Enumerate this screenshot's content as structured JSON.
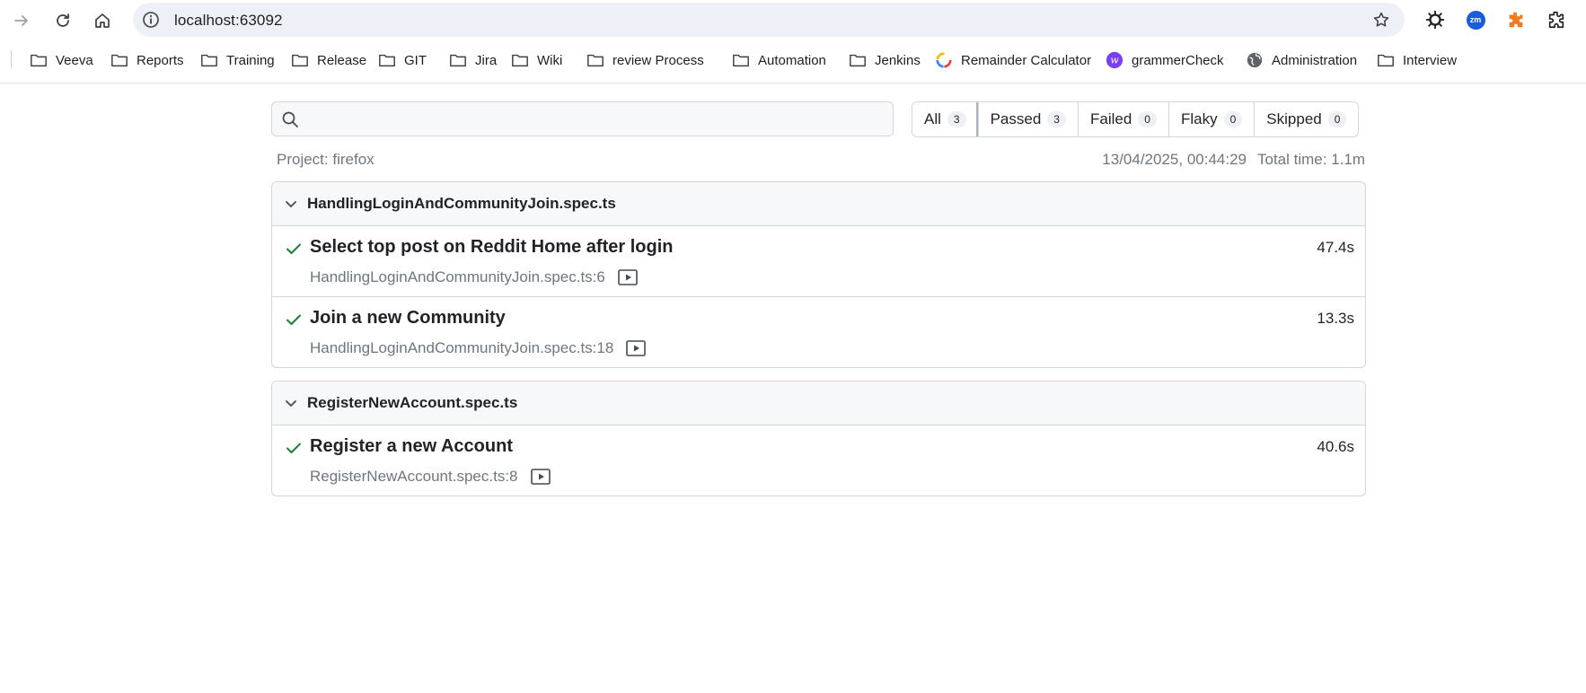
{
  "browser": {
    "url": "localhost:63092",
    "bookmarks": [
      {
        "label": "Veeva",
        "icon": "folder-icon"
      },
      {
        "label": "Reports",
        "icon": "folder-icon"
      },
      {
        "label": "Training",
        "icon": "folder-icon"
      },
      {
        "label": "Release",
        "icon": "folder-icon"
      },
      {
        "label": "GIT",
        "icon": "folder-icon"
      },
      {
        "label": "Jira",
        "icon": "folder-icon"
      },
      {
        "label": "Wiki",
        "icon": "folder-icon"
      },
      {
        "label": "review Process",
        "icon": "folder-icon"
      },
      {
        "label": "Automation",
        "icon": "folder-icon"
      },
      {
        "label": "Jenkins",
        "icon": "folder-icon"
      },
      {
        "label": "Remainder Calculator",
        "icon": "calculator-logo-icon"
      },
      {
        "label": "grammerCheck",
        "icon": "grammar-logo-icon"
      },
      {
        "label": "Administration",
        "icon": "globe-icon"
      },
      {
        "label": "Interview",
        "icon": "folder-icon"
      }
    ],
    "extensions": {
      "zm_label": "zm"
    }
  },
  "report": {
    "search": {
      "placeholder": "",
      "value": ""
    },
    "filters": [
      {
        "label": "All",
        "count": "3",
        "selected": true
      },
      {
        "label": "Passed",
        "count": "3",
        "selected": false
      },
      {
        "label": "Failed",
        "count": "0",
        "selected": false
      },
      {
        "label": "Flaky",
        "count": "0",
        "selected": false
      },
      {
        "label": "Skipped",
        "count": "0",
        "selected": false
      }
    ],
    "project": "Project: firefox",
    "timestamp": "13/04/2025, 00:44:29",
    "total_time": "Total time: 1.1m",
    "files": [
      {
        "name": "HandlingLoginAndCommunityJoin.spec.ts",
        "tests": [
          {
            "title": "Select top post on Reddit Home after login",
            "location": "HandlingLoginAndCommunityJoin.spec.ts:6",
            "duration": "47.4s",
            "status": "passed"
          },
          {
            "title": "Join a new Community",
            "location": "HandlingLoginAndCommunityJoin.spec.ts:18",
            "duration": "13.3s",
            "status": "passed"
          }
        ]
      },
      {
        "name": "RegisterNewAccount.spec.ts",
        "tests": [
          {
            "title": "Register a new Account",
            "location": "RegisterNewAccount.spec.ts:8",
            "duration": "40.6s",
            "status": "passed"
          }
        ]
      }
    ]
  },
  "colors": {
    "pass_green": "#1a7f37",
    "accent": "#1a5be0"
  }
}
